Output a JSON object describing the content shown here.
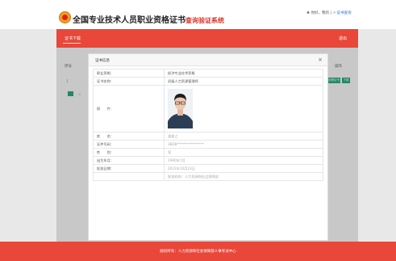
{
  "header": {
    "title_main": "全国专业技术人员职业资格证书",
    "title_accent": "查询验证系统",
    "user_text": "♣ 你好，我的 | ",
    "user_link": "↗ 证书查询"
  },
  "nav": {
    "item": "证书下载",
    "right": "退出"
  },
  "background": {
    "col_left": "序号",
    "col_right": "操作",
    "row_num": "1",
    "btn_view": "查看证书",
    "btn_download": "下载",
    "pager_dot": "<"
  },
  "modal": {
    "title": "证书信息",
    "close": "×",
    "rows": [
      {
        "label": "职业资格：",
        "value": "经济专业技术资格"
      },
      {
        "label": "证书名称：",
        "value": "初级人力资源管理师"
      },
      {
        "label": "照　　片：",
        "value": ""
      },
      {
        "label": "姓　　名：",
        "value": "潘俊之"
      },
      {
        "label": "证件号码：",
        "value": "3BD8****************"
      },
      {
        "label": "性　　别：",
        "value": "男"
      },
      {
        "label": "出生年月：",
        "value": "1990年7月"
      },
      {
        "label": "批准日期：",
        "value": "2021年10月23日"
      },
      {
        "label": "",
        "value": "批准机构：人力资源和社会保障部"
      }
    ]
  },
  "footer": {
    "text": "版权所有：人力资源和社会保障部人事考试中心"
  },
  "colors": {
    "brand_red": "#e8473a",
    "accent_green": "#2aa57d",
    "link_blue": "#1e6fd9"
  }
}
